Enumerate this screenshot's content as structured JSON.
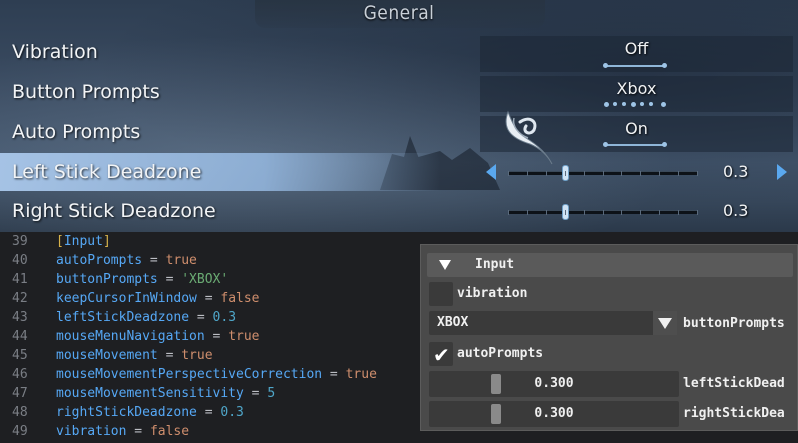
{
  "game": {
    "section_title": "General",
    "rows": [
      {
        "label": "Vibration",
        "value": "Off"
      },
      {
        "label": "Button Prompts",
        "value": "Xbox"
      },
      {
        "label": "Auto Prompts",
        "value": "On"
      },
      {
        "label": "Left Stick Deadzone",
        "value": "0.3",
        "level": 0.3
      },
      {
        "label": "Right Stick Deadzone",
        "value": "0.3",
        "level": 0.3
      }
    ],
    "accent_color": "#5aa8ef"
  },
  "editor": {
    "lines": [
      {
        "num": "39",
        "section": "Input"
      },
      {
        "num": "40",
        "key": "autoPrompts",
        "value": "true",
        "type": "bool"
      },
      {
        "num": "41",
        "key": "buttonPrompts",
        "value": "'XBOX'",
        "type": "str"
      },
      {
        "num": "42",
        "key": "keepCursorInWindow",
        "value": "false",
        "type": "bool"
      },
      {
        "num": "43",
        "key": "leftStickDeadzone",
        "value": "0.3",
        "type": "num"
      },
      {
        "num": "44",
        "key": "mouseMenuNavigation",
        "value": "true",
        "type": "bool"
      },
      {
        "num": "45",
        "key": "mouseMovement",
        "value": "true",
        "type": "bool"
      },
      {
        "num": "46",
        "key": "mouseMovementPerspectiveCorrection",
        "value": "true",
        "type": "bool"
      },
      {
        "num": "47",
        "key": "mouseMovementSensitivity",
        "value": "5",
        "type": "num"
      },
      {
        "num": "48",
        "key": "rightStickDeadzone",
        "value": "0.3",
        "type": "num"
      },
      {
        "num": "49",
        "key": "vibration",
        "value": "false",
        "type": "bool"
      }
    ]
  },
  "inspector": {
    "title": "Input",
    "vibration_label": "vibration",
    "vibration_checked": false,
    "button_prompts_value": "XBOX",
    "button_prompts_label": "buttonPrompts",
    "auto_prompts_label": "autoPrompts",
    "auto_prompts_checked": true,
    "left_stick_value": "0.300",
    "left_stick_label": "leftStickDead",
    "left_stick_level": 0.3,
    "right_stick_value": "0.300",
    "right_stick_label": "rightStickDea",
    "right_stick_level": 0.3
  }
}
